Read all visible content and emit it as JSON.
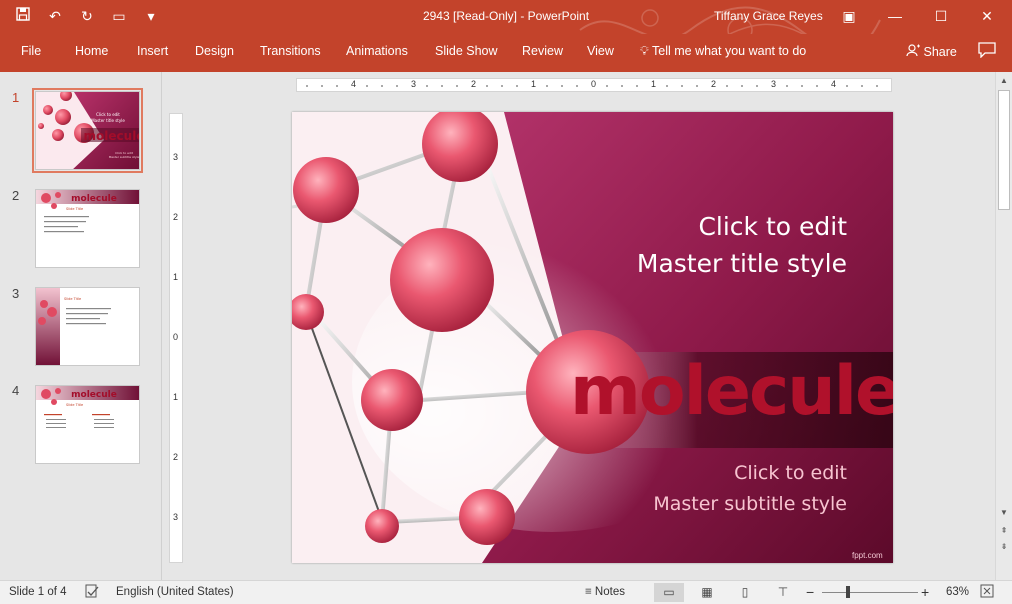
{
  "titlebar": {
    "doc_title": "2943 [Read-Only]  -  PowerPoint",
    "user": "Tiffany Grace Reyes",
    "qat_icons": [
      "save-icon",
      "undo-icon",
      "redo-icon",
      "present-icon",
      "customize-icon"
    ],
    "controls": [
      "ribbon-display-icon",
      "minimize-icon",
      "maximize-icon",
      "close-icon"
    ]
  },
  "ribbon": {
    "tabs": [
      "File",
      "Home",
      "Insert",
      "Design",
      "Transitions",
      "Animations",
      "Slide Show",
      "Review",
      "View"
    ],
    "tell_me": "Tell me what you want to do",
    "share": "Share"
  },
  "thumbnails": [
    {
      "number": "1",
      "selected": true
    },
    {
      "number": "2",
      "selected": false
    },
    {
      "number": "3",
      "selected": false
    },
    {
      "number": "4",
      "selected": false
    }
  ],
  "thumb_text": {
    "t1_title": "Click to edit Master title style",
    "t1_brand": "molecule",
    "t2_brand": "molecule",
    "t2_title": "Slide Title",
    "t3_title": "Slide Title",
    "t4_brand": "molecule",
    "t4_title": "Slide Title"
  },
  "ruler": {
    "h_labels": [
      "4",
      "3",
      "2",
      "1",
      "0",
      "1",
      "2",
      "3",
      "4"
    ],
    "v_labels": [
      "3",
      "2",
      "1",
      "0",
      "1",
      "2",
      "3"
    ]
  },
  "slide": {
    "title_line1": "Click to edit",
    "title_line2": "Master title style",
    "brand": "molecule",
    "subtitle_line1": "Click to edit",
    "subtitle_line2": "Master subtitle style",
    "watermark": "fppt.com",
    "colors": {
      "accent": "#c3432b",
      "magenta": "#8e1741",
      "sphere": "#e8546a"
    }
  },
  "statusbar": {
    "slide_info": "Slide 1 of 4",
    "language": "English (United States)",
    "notes": "Notes",
    "zoom": "63%"
  }
}
